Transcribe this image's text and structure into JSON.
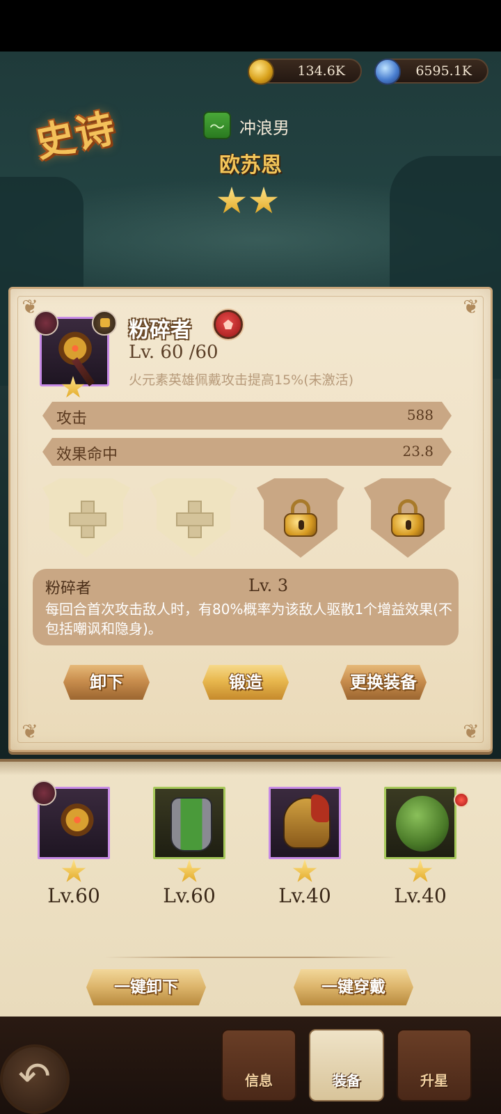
{
  "currency": {
    "gold": "134.6K",
    "orb": "6595.1K"
  },
  "hero": {
    "rarity": "史诗",
    "class_name": "冲浪男",
    "name": "欧苏恩",
    "stars": 2
  },
  "item": {
    "name": "粉碎者",
    "level": "Lv. 60 /60",
    "bonus_desc": "火元素英雄佩戴攻击提高15%(未激活)",
    "stats": [
      {
        "label": "攻击",
        "value": "588"
      },
      {
        "label": "效果命中",
        "value": "23.8"
      }
    ],
    "slots": [
      {
        "state": "open"
      },
      {
        "state": "open"
      },
      {
        "state": "locked"
      },
      {
        "state": "locked"
      }
    ]
  },
  "skill": {
    "name": "粉碎者",
    "level": "Lv. 3",
    "desc": "每回合首次攻击敌人时，有80%概率为该敌人驱散1个增益效果(不包括嘲讽和隐身)。"
  },
  "actions": {
    "unequip": "卸下",
    "forge": "锻造",
    "replace": "更换装备"
  },
  "equipment": [
    {
      "name": "weapon",
      "level": "Lv.60"
    },
    {
      "name": "armor",
      "level": "Lv.60"
    },
    {
      "name": "helmet",
      "level": "Lv.40"
    },
    {
      "name": "accessory",
      "level": "Lv.40"
    }
  ],
  "tray_actions": {
    "unequip_all": "一键卸下",
    "equip_all": "一键穿戴"
  },
  "nav": {
    "info": "信息",
    "equip": "装备",
    "upgrade": "升星"
  },
  "colors": {
    "accent_gold": "#f3c65a",
    "card_bg": "#f3e7cf",
    "stat_bar": "#c9a784",
    "rarity_purple": "#c78be6"
  }
}
